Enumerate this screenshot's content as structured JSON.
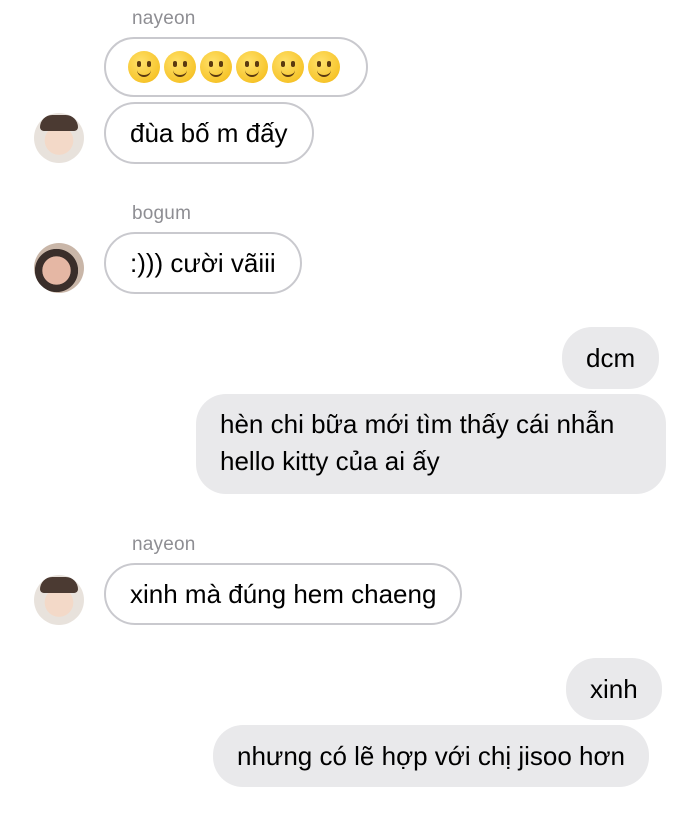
{
  "messages": [
    {
      "sender": "nayeon",
      "emoji": "🙂🙂🙂🙂🙂🙂",
      "text": "đùa bố m đấy"
    },
    {
      "sender": "bogum",
      "text": ":))) cười vãiii"
    },
    {
      "outgoing": [
        "dcm",
        "hèn chi bữa mới tìm thấy cái nhẫn hello kitty của ai ấy"
      ]
    },
    {
      "sender": "nayeon",
      "text": "xinh mà đúng hem chaeng"
    },
    {
      "outgoing": [
        "xinh",
        "nhưng có lẽ hợp với chị jisoo hơn"
      ]
    }
  ],
  "icons": {
    "smiley": "slightly-smiling-face-emoji",
    "avatar_nayeon": "avatar",
    "avatar_bogum": "avatar"
  },
  "colors": {
    "outgoing_bubble": "#e9e9eb",
    "incoming_border": "#c9c9ce",
    "sender_name": "#8e8e93"
  }
}
